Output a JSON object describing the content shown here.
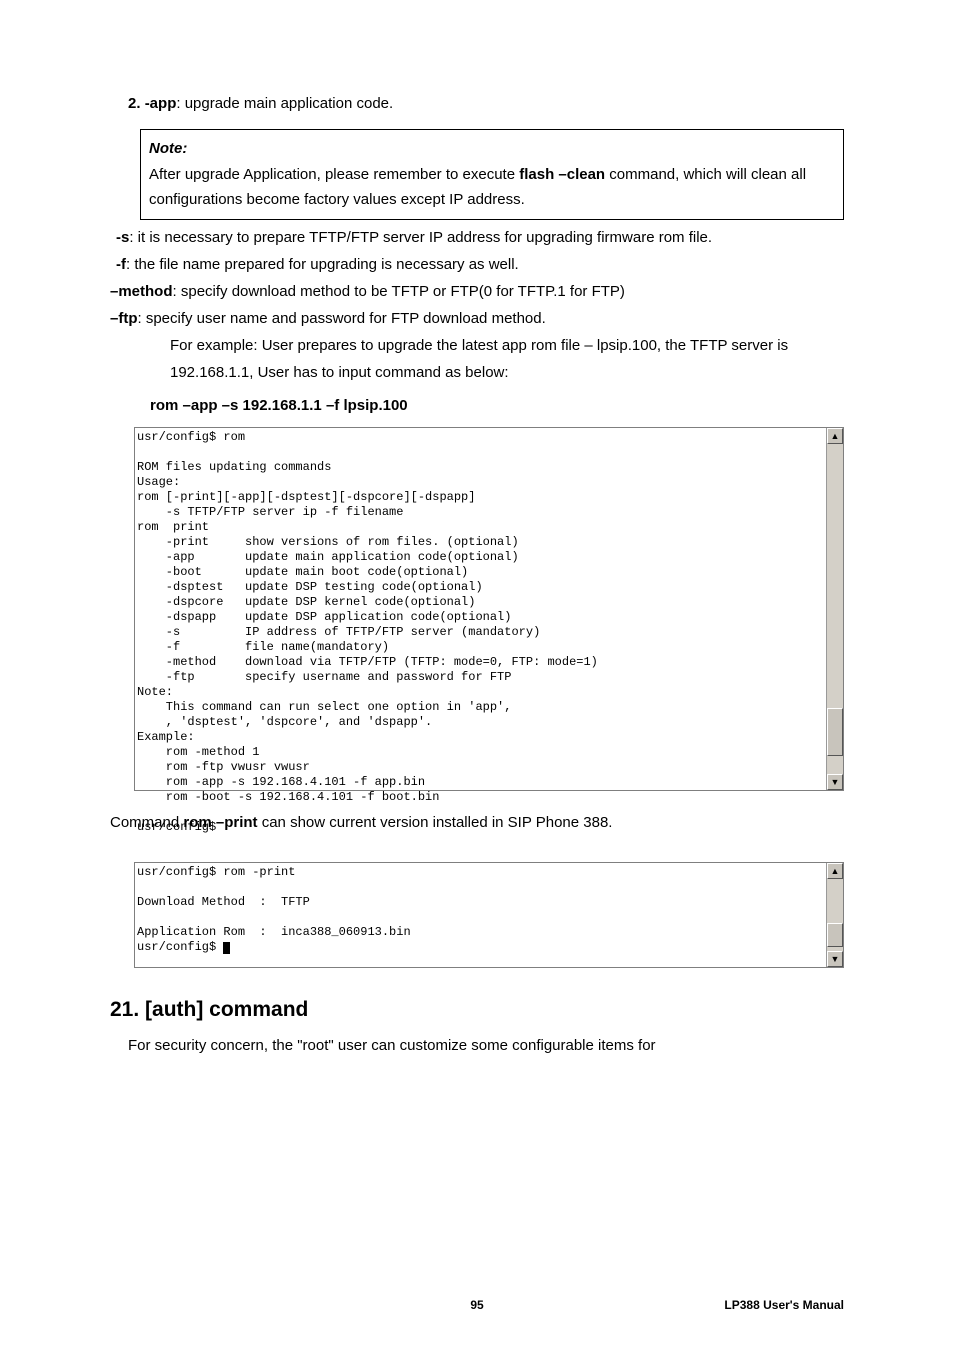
{
  "para_app": {
    "num": "2. ",
    "flag": "-app",
    "rest": ": upgrade main application code."
  },
  "note": {
    "title": "Note:",
    "line1a": "After upgrade Application, please remember to execute ",
    "line1b": "flash –clean",
    "line1c": " command, which will clean all configurations become factory values except IP address."
  },
  "para_s": {
    "flag": "-s",
    "rest": ": it is necessary to prepare TFTP/FTP server IP address for upgrading firmware rom file."
  },
  "para_f": {
    "flag": "-f",
    "rest": ": the file name prepared for upgrading is necessary as well."
  },
  "para_method": {
    "flag": "–method",
    "rest": ": specify download method to be TFTP or FTP(0 for TFTP.1 for FTP)"
  },
  "para_ftp": {
    "flag": "–ftp",
    "rest": ": specify user name and password for FTP download method."
  },
  "example_lines": [
    "For example: User prepares to upgrade the latest app rom file – lpsip.100, the TFTP server is 192.168.1.1, User has to input command as below:"
  ],
  "example_cmd": "rom –app –s 192.168.1.1 –f lpsip.100",
  "terminal1": "usr/config$ rom\n\nROM files updating commands\nUsage:\nrom [-print][-app][-dsptest][-dspcore][-dspapp]\n    -s TFTP/FTP server ip -f filename\nrom  print\n    -print     show versions of rom files. (optional)\n    -app       update main application code(optional)\n    -boot      update main boot code(optional)\n    -dsptest   update DSP testing code(optional)\n    -dspcore   update DSP kernel code(optional)\n    -dspapp    update DSP application code(optional)\n    -s         IP address of TFTP/FTP server (mandatory)\n    -f         file name(mandatory)\n    -method    download via TFTP/FTP (TFTP: mode=0, FTP: mode=1)\n    -ftp       specify username and password for FTP\nNote:\n    This command can run select one option in 'app',\n    , 'dsptest', 'dspcore', and 'dspapp'.\nExample:\n    rom -method 1\n    rom -ftp vwusr vwusr\n    rom -app -s 192.168.4.101 -f app.bin\n    rom -boot -s 192.168.4.101 -f boot.bin\n\nusr/config$",
  "mid_para": {
    "a": "Command ",
    "b": "rom –print",
    "c": " can show current version installed in SIP Phone 388."
  },
  "terminal2_lines": {
    "l1": "usr/config$ rom -print",
    "l2": "",
    "l3": "Download Method  :  TFTP",
    "l4": "",
    "l5": "Application Rom  :  inca388_060913.bin",
    "l6": "usr/config$ "
  },
  "section_title": "21. [auth] command",
  "section_body": "For security concern, the \"root\" user can customize some configurable items for",
  "footer": {
    "page": "95",
    "manual": "LP388  User's  Manual"
  }
}
